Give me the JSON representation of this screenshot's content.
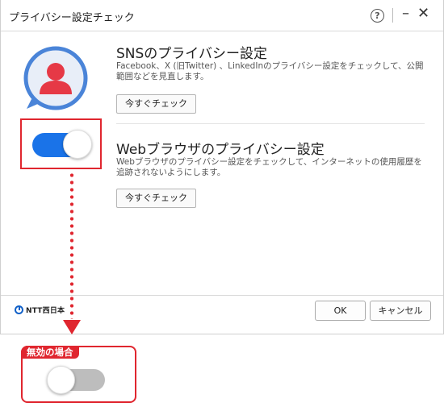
{
  "window": {
    "title": "プライバシー設定チェック",
    "help_glyph": "?",
    "minimize_glyph": "–",
    "close_glyph": "✕"
  },
  "toggle_enabled": {
    "state": "on",
    "color": "#1a73e8"
  },
  "sections": [
    {
      "title": "SNSのプライバシー設定",
      "description": "Facebook、X (旧Twitter) 、LinkedInのプライバシー設定をチェックして、公開範囲などを見直します。",
      "button_label": "今すぐチェック"
    },
    {
      "title": "Webブラウザのプライバシー設定",
      "description": "Webブラウザのプライバシー設定をチェックして、インターネットの使用履歴を追跡されないようにします。",
      "button_label": "今すぐチェック"
    }
  ],
  "footer": {
    "logo_text": "NTT西日本",
    "ok_label": "OK",
    "cancel_label": "キャンセル"
  },
  "annotation": {
    "label": "無効の場合",
    "toggle_state": "off",
    "accent_color": "#e0262f"
  }
}
